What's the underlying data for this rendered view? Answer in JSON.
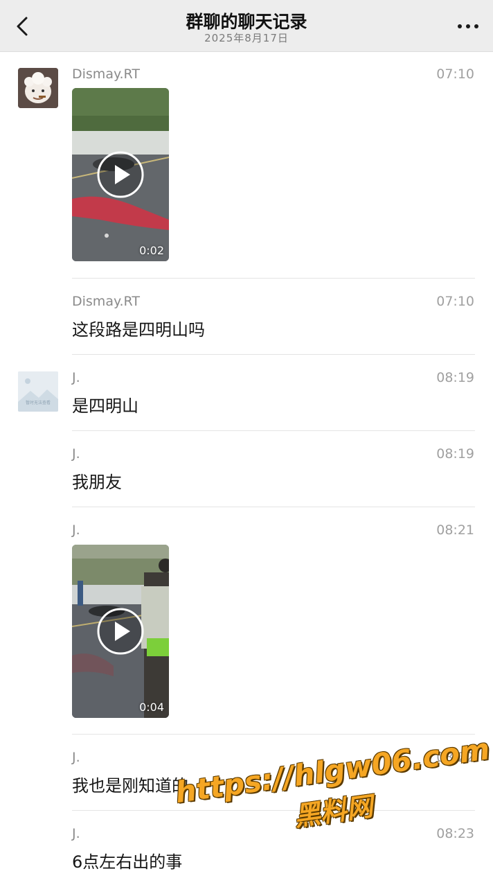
{
  "header": {
    "title": "群聊的聊天记录",
    "date": "2025年8月17日",
    "back_icon": "chevron-left-icon",
    "more_icon": "more-dots-icon"
  },
  "messages": [
    {
      "sender": "Dismay.RT",
      "time": "07:10",
      "type": "video",
      "duration": "0:02",
      "avatar": "goat-avatar"
    },
    {
      "sender": "Dismay.RT",
      "time": "07:10",
      "type": "text",
      "text": "这段路是四明山吗"
    },
    {
      "sender": "J.",
      "time": "08:19",
      "type": "text",
      "text": "是四明山",
      "avatar": "image-placeholder-avatar",
      "avatar_caption": "暂时无法查看"
    },
    {
      "sender": "J.",
      "time": "08:19",
      "type": "text",
      "text": "我朋友"
    },
    {
      "sender": "J.",
      "time": "08:21",
      "type": "video",
      "duration": "0:04"
    },
    {
      "sender": "J.",
      "time": "08:22",
      "type": "text",
      "text": "我也是刚知道的"
    },
    {
      "sender": "J.",
      "time": "08:23",
      "type": "text",
      "text": "6点左右出的事"
    }
  ],
  "watermark": {
    "url": "https://hlgw06.com",
    "name": "黑料网",
    "color": "#f5a623"
  },
  "colors": {
    "header_bg": "#ededed",
    "divider": "#e4e4e4",
    "meta_text": "#8a8a8a"
  }
}
